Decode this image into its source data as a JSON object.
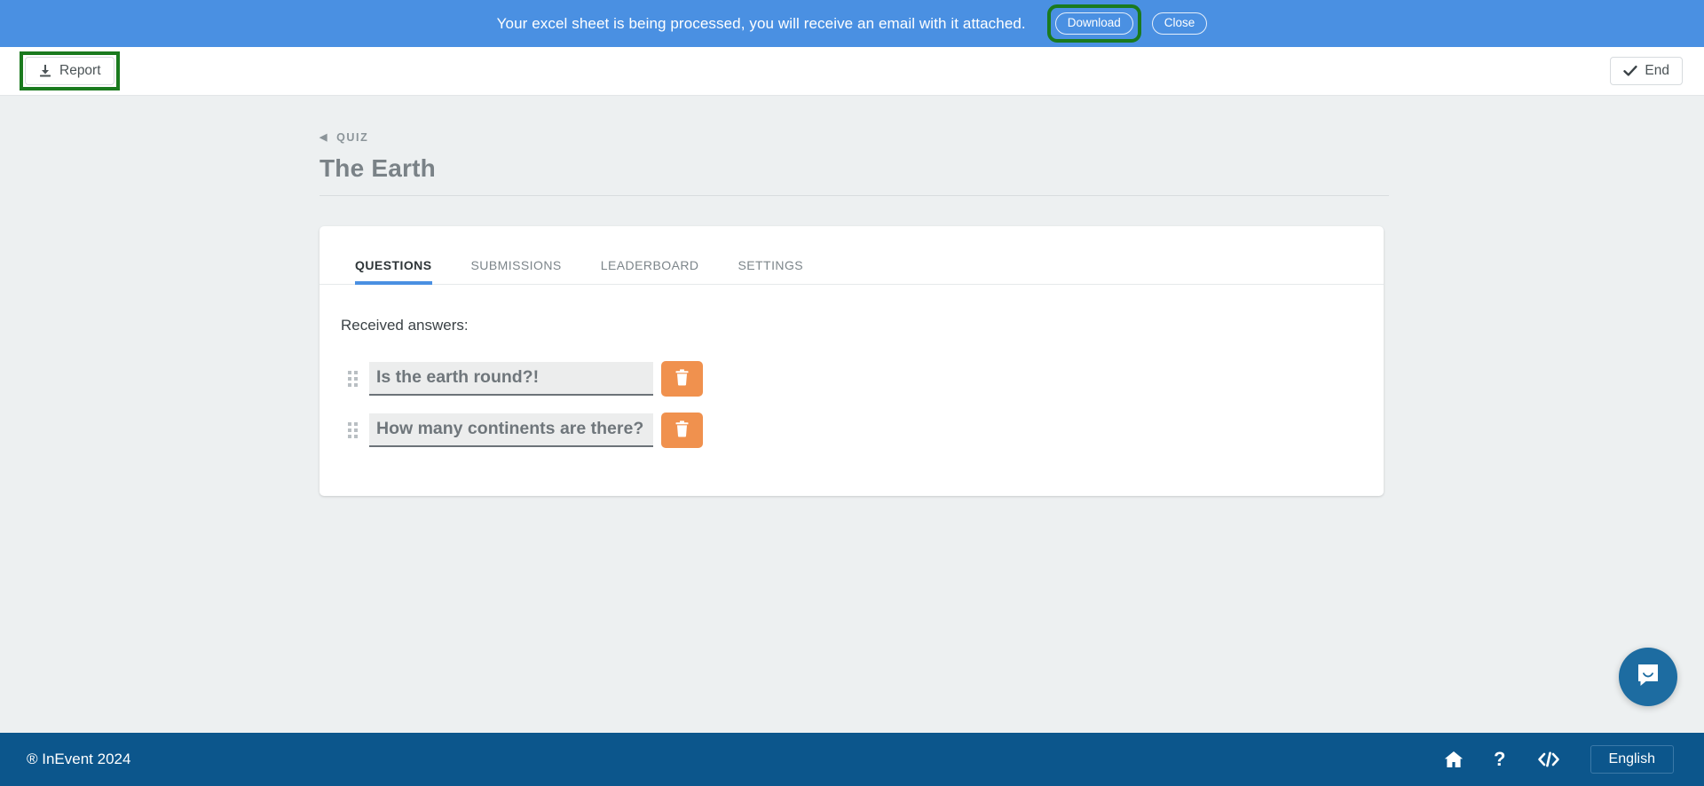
{
  "banner": {
    "message": "Your excel sheet is being processed, you will receive an email with it attached.",
    "download_label": "Download",
    "close_label": "Close",
    "background_color": "#4a90e2",
    "highlight_color": "#1a7a1e"
  },
  "header": {
    "report_label": "Report",
    "report_icon": "download-icon",
    "end_label": "End",
    "end_icon": "check-icon"
  },
  "breadcrumb": {
    "back_icon": "left-caret-icon",
    "label": "QUIZ"
  },
  "page": {
    "title": "The Earth"
  },
  "tabs": [
    {
      "label": "QUESTIONS",
      "active": true
    },
    {
      "label": "SUBMISSIONS",
      "active": false
    },
    {
      "label": "LEADERBOARD",
      "active": false
    },
    {
      "label": "SETTINGS",
      "active": false
    }
  ],
  "questions_panel": {
    "section_label": "Received answers:",
    "items": [
      {
        "value": "Is the earth round?!",
        "delete_icon": "trash-icon"
      },
      {
        "value": "How many continents are there?",
        "delete_icon": "trash-icon"
      }
    ],
    "delete_button_color": "#f0914e"
  },
  "chat": {
    "icon": "chat-bubble-icon",
    "color": "#1d6ca1"
  },
  "footer": {
    "copyright": "® InEvent 2024",
    "home_icon": "home-icon",
    "help_icon": "question-mark-icon",
    "code_icon": "code-brackets-icon",
    "language": "English",
    "background_color": "#0c568c"
  }
}
